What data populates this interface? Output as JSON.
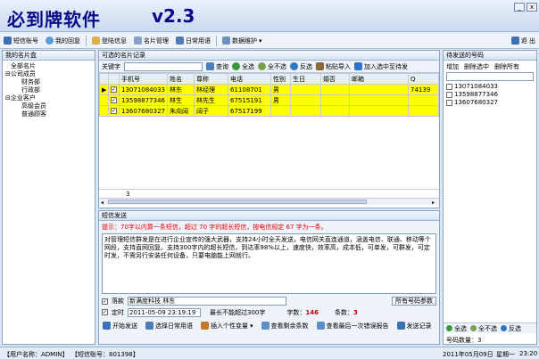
{
  "app": {
    "title": "必到牌软件",
    "version": "v2.3",
    "win_min": "_",
    "win_close": "x"
  },
  "toolbar": {
    "sms_account": "短信账号",
    "my_reply": "我的回复",
    "login_info": "登陆信息",
    "card_manage": "名片管理",
    "daily_phrases": "日常用语",
    "data_maintain": "数据维护",
    "exit": "退 出",
    "data_maintain_arrow": "▾"
  },
  "left": {
    "header": "我的名片盒",
    "tree": [
      "全部名片",
      "公司成员",
      "财务部",
      "行政部",
      "企业客户",
      "高级会员",
      "普通顾客"
    ]
  },
  "center": {
    "header": "可选的名片记录",
    "keyword_label": "关键字",
    "query": "查询",
    "select_all": "全选",
    "select_none": "全不选",
    "invert": "反选",
    "paste_import": "粘贴导入",
    "add_to_pending": "加入选中至待发",
    "columns": [
      "手机号",
      "姓名",
      "尊称",
      "电话",
      "性别",
      "生日",
      "婚否",
      "邮箱",
      "Q"
    ],
    "rows": [
      {
        "phone": "13071084033",
        "name": "林东",
        "title": "林经理",
        "tel": "61108701",
        "gender": "男",
        "birthday": "",
        "married": "",
        "email": "",
        "q": "74139"
      },
      {
        "phone": "13598877346",
        "name": "林生",
        "title": "林先生",
        "tel": "67515191",
        "gender": "男",
        "birthday": "",
        "married": "",
        "email": "",
        "q": ""
      },
      {
        "phone": "13607680327",
        "name": "朱向阔",
        "title": "阔子",
        "tel": "67517199",
        "gender": "",
        "birthday": "",
        "married": "",
        "email": "",
        "q": ""
      }
    ],
    "count": "3"
  },
  "right": {
    "header": "待发送的号码",
    "add": "增加",
    "delete_selected": "删除选中",
    "delete_all": "删除所有",
    "numbers": [
      "13071084033",
      "13598877346",
      "13607680327"
    ],
    "select_all": "全选",
    "select_none": "全不选",
    "invert": "反选",
    "count_label": "号码数量：3"
  },
  "compose": {
    "header": "短信发送",
    "hint": "提示：70字以内算一条短信，超过 70 字的超长短信，按电信规定 67 字为一条。",
    "body": "    对管理短信群发是在进行企业宣传的强大武器，支持24小时全天发送，电信网关直连通道，涵盖电信、联通、移动等个网段，支持直网回复。支持300字内的超长短信，到达率98%以上，速度快，效率高，成本低，可单发，可群发，可定时发，不需另行安装任何设备，只要电脑能上网就行。",
    "sign_label": "落款",
    "sign_value": "新满度科技 林东",
    "all_numbers_btn": "所有号码参数",
    "timed_label": "定时",
    "timed_value": "2011-05-09 23:19:19",
    "max_len_label": "最长不能超过300字",
    "char_count_label": "字数：",
    "char_count": "146",
    "msg_count_label": "条数：",
    "msg_count": "3",
    "start_send": "开始发送",
    "select_phrase": "选择日常用语",
    "insert_var": "插入个性变量",
    "view_remaining": "查看剩余条数",
    "view_last_report": "查看最后一次错误报告",
    "send_record": "发送记录"
  },
  "status": {
    "user": "【用户名称：ADMIN】",
    "sms_account": "【短信账号：801398】",
    "date": "2011年05月09日",
    "weekday": "星期一",
    "time": "23:20"
  },
  "colors": {
    "highlight_row": "#ffff00",
    "title": "#0a0a8a",
    "hint": "#e00000",
    "count": "#c00000"
  }
}
